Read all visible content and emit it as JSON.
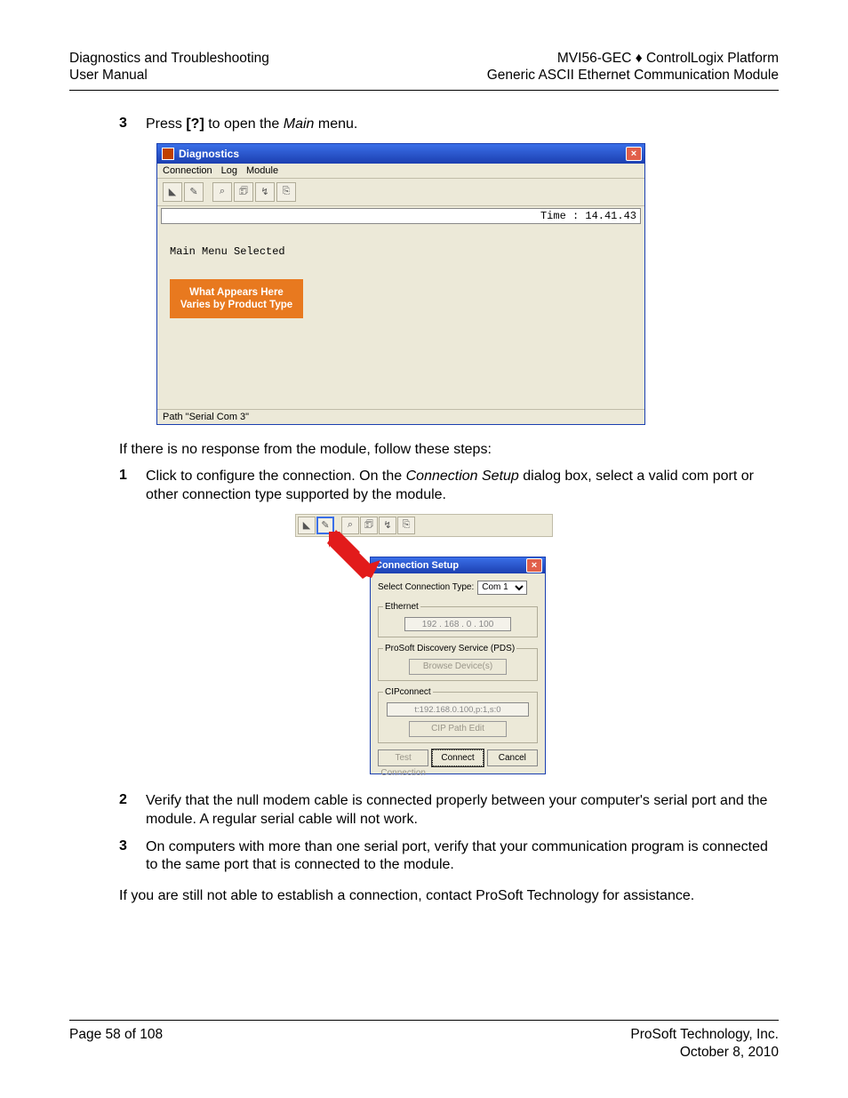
{
  "header": {
    "left1": "Diagnostics and Troubleshooting",
    "left2": "User Manual",
    "right1": "MVI56-GEC ♦ ControlLogix Platform",
    "right2": "Generic ASCII Ethernet Communication Module"
  },
  "step3": {
    "num": "3",
    "pre": "Press ",
    "key": "[?]",
    "mid": " to open the ",
    "ital": "Main",
    "post": " menu."
  },
  "diag": {
    "title": "Diagnostics",
    "menus": [
      "Connection",
      "Log",
      "Module"
    ],
    "time_label": "Time : 14.41.43",
    "console_line": "Main Menu Selected",
    "orange1": "What Appears Here",
    "orange2": "Varies by Product Type",
    "status": "Path \"Serial Com 3\""
  },
  "para1": "If there is no response from the module, follow these steps:",
  "step1b": {
    "num": "1",
    "pre": "Click to configure the connection. On the ",
    "ital": "Connection Setup",
    "post": " dialog box, select a valid com port or other connection type supported by the module."
  },
  "conn": {
    "title": "Connection Setup",
    "sel_label": "Select Connection Type:",
    "sel_value": "Com 1",
    "eth_legend": "Ethernet",
    "eth_ip": "192 . 168 .   0 . 100",
    "pds_legend": "ProSoft Discovery Service (PDS)",
    "pds_btn": "Browse Device(s)",
    "cip_legend": "CIPconnect",
    "cip_path": "t:192.168.0.100,p:1,s:0",
    "cip_btn": "CIP Path Edit",
    "btn_test": "Test Connection",
    "btn_connect": "Connect",
    "btn_cancel": "Cancel"
  },
  "step2b": {
    "num": "2",
    "text": "Verify that the null modem cable is connected properly between your computer's serial port and the module. A regular serial cable will not work."
  },
  "step3b": {
    "num": "3",
    "text": "On computers with more than one serial port, verify that your communication program is connected to the same port that is connected to the module."
  },
  "para2": "If you are still not able to establish a connection, contact ProSoft Technology for assistance.",
  "footer": {
    "left": "Page 58 of 108",
    "right1": "ProSoft Technology, Inc.",
    "right2": "October 8, 2010"
  }
}
